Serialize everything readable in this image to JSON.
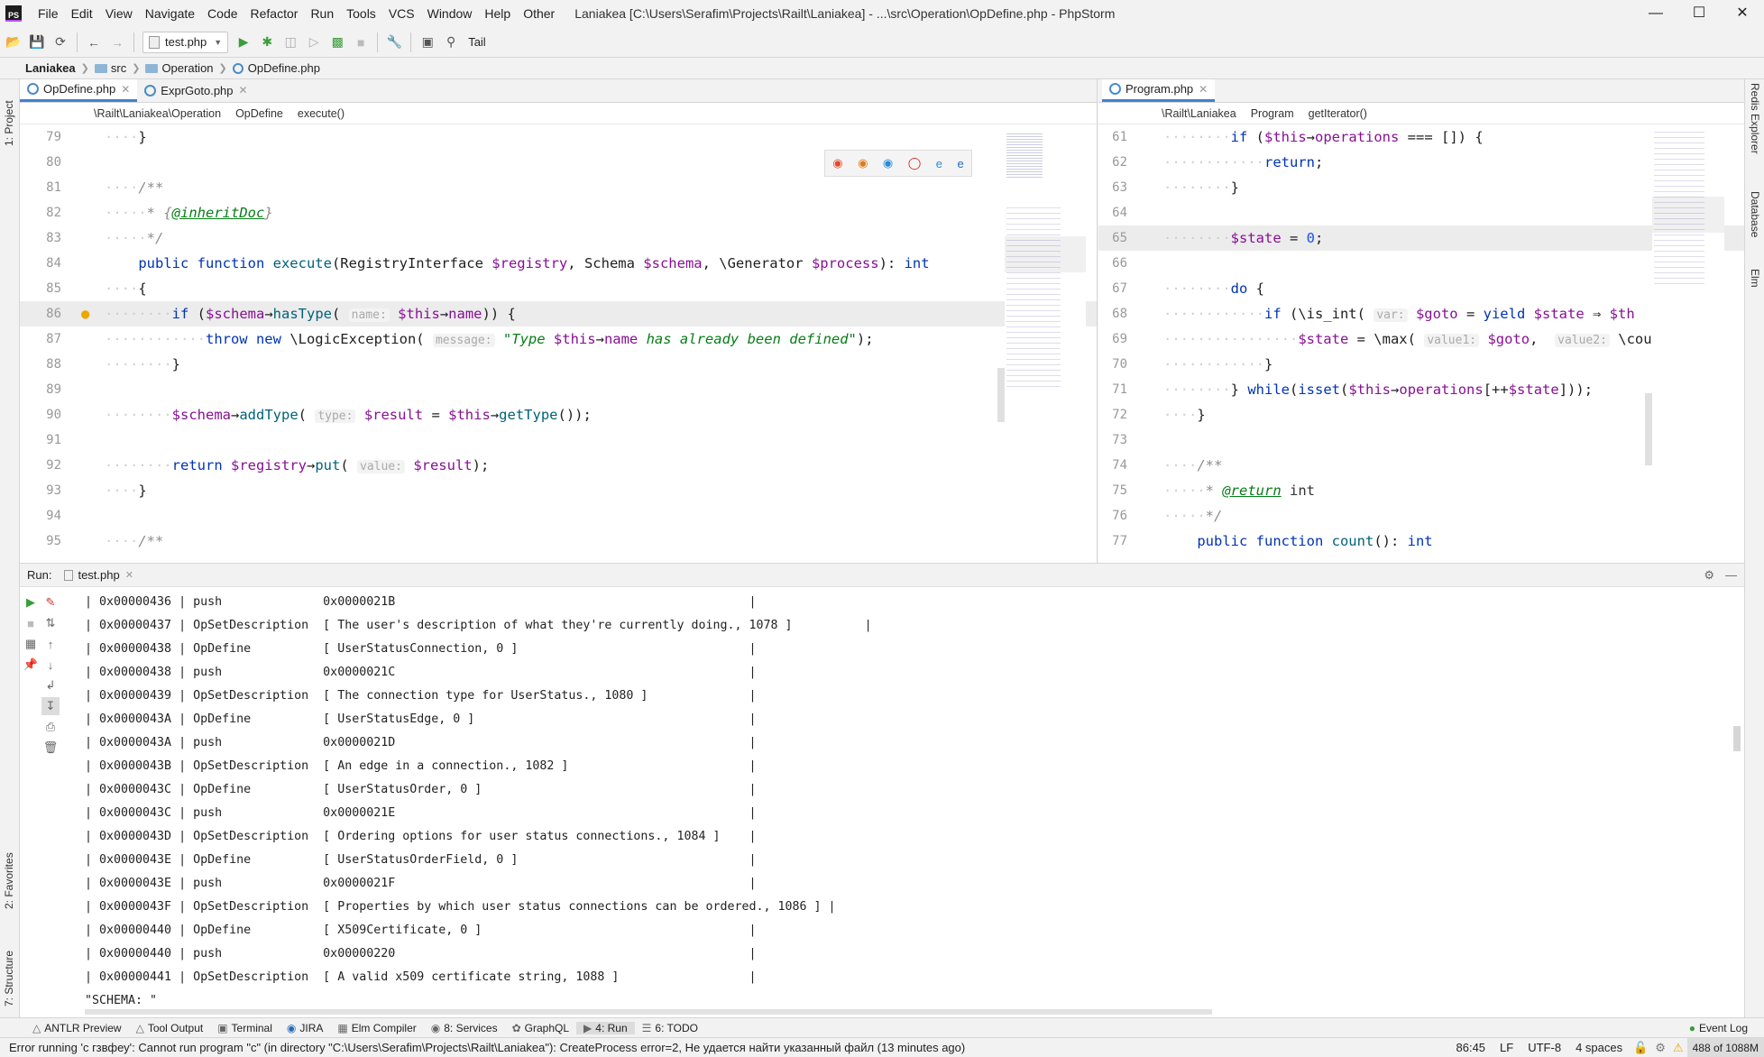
{
  "window": {
    "title": "Laniakea [C:\\Users\\Serafim\\Projects\\Railt\\Laniakea] - ...\\src\\Operation\\OpDefine.php - PhpStorm",
    "menu": [
      "File",
      "Edit",
      "View",
      "Navigate",
      "Code",
      "Refactor",
      "Run",
      "Tools",
      "VCS",
      "Window",
      "Help",
      "Other"
    ]
  },
  "toolbar": {
    "run_config": "test.php",
    "tail_label": "Tail"
  },
  "breadcrumb": [
    "Laniakea",
    "src",
    "Operation",
    "OpDefine.php"
  ],
  "left_strip": {
    "project": "1: Project",
    "favorites": "2: Favorites",
    "structure": "7: Structure"
  },
  "right_strip": {
    "redis": "Redis Explorer",
    "database": "Database",
    "elm": "Elm"
  },
  "left_editor": {
    "tabs": [
      {
        "label": "OpDefine.php"
      },
      {
        "label": "ExprGoto.php"
      }
    ],
    "crumbs": [
      "\\Railt\\Laniakea\\Operation",
      "OpDefine",
      "execute()"
    ]
  },
  "right_editor": {
    "tabs": [
      {
        "label": "Program.php"
      }
    ],
    "crumbs": [
      "\\Railt\\Laniakea",
      "Program",
      "getIterator()"
    ]
  },
  "run": {
    "label": "Run:",
    "tab": "test.php",
    "lines": [
      "| 0x00000436 | push              0x0000021B                                                 |",
      "| 0x00000437 | OpSetDescription  [ The user's description of what they're currently doing., 1078 ]          |",
      "| 0x00000438 | OpDefine          [ UserStatusConnection, 0 ]                                |",
      "| 0x00000438 | push              0x0000021C                                                 |",
      "| 0x00000439 | OpSetDescription  [ The connection type for UserStatus., 1080 ]              |",
      "| 0x0000043A | OpDefine          [ UserStatusEdge, 0 ]                                      |",
      "| 0x0000043A | push              0x0000021D                                                 |",
      "| 0x0000043B | OpSetDescription  [ An edge in a connection., 1082 ]                         |",
      "| 0x0000043C | OpDefine          [ UserStatusOrder, 0 ]                                     |",
      "| 0x0000043C | push              0x0000021E                                                 |",
      "| 0x0000043D | OpSetDescription  [ Ordering options for user status connections., 1084 ]    |",
      "| 0x0000043E | OpDefine          [ UserStatusOrderField, 0 ]                                |",
      "| 0x0000043E | push              0x0000021F                                                 |",
      "| 0x0000043F | OpSetDescription  [ Properties by which user status connections can be ordered., 1086 ] |",
      "| 0x00000440 | OpDefine          [ X509Certificate, 0 ]                                     |",
      "| 0x00000440 | push              0x00000220                                                 |",
      "| 0x00000441 | OpSetDescription  [ A valid x509 certificate string, 1088 ]                  |",
      "\"SCHEMA: \""
    ]
  },
  "tool_windows": [
    "ANTLR Preview",
    "Tool Output",
    "Terminal",
    "JIRA",
    "Elm Compiler",
    "8: Services",
    "GraphQL",
    "4: Run",
    "6: TODO"
  ],
  "event_log": "Event Log",
  "status": {
    "message": "Error running 'c гзвфеу': Cannot run program \"c\" (in directory \"C:\\Users\\Serafim\\Projects\\Railt\\Laniakea\"): CreateProcess error=2, Не удается найти указанный файл (13 minutes ago)",
    "position": "86:45",
    "line_sep": "LF",
    "encoding": "UTF-8",
    "indent": "4 spaces",
    "memory": "488 of 1088M"
  }
}
